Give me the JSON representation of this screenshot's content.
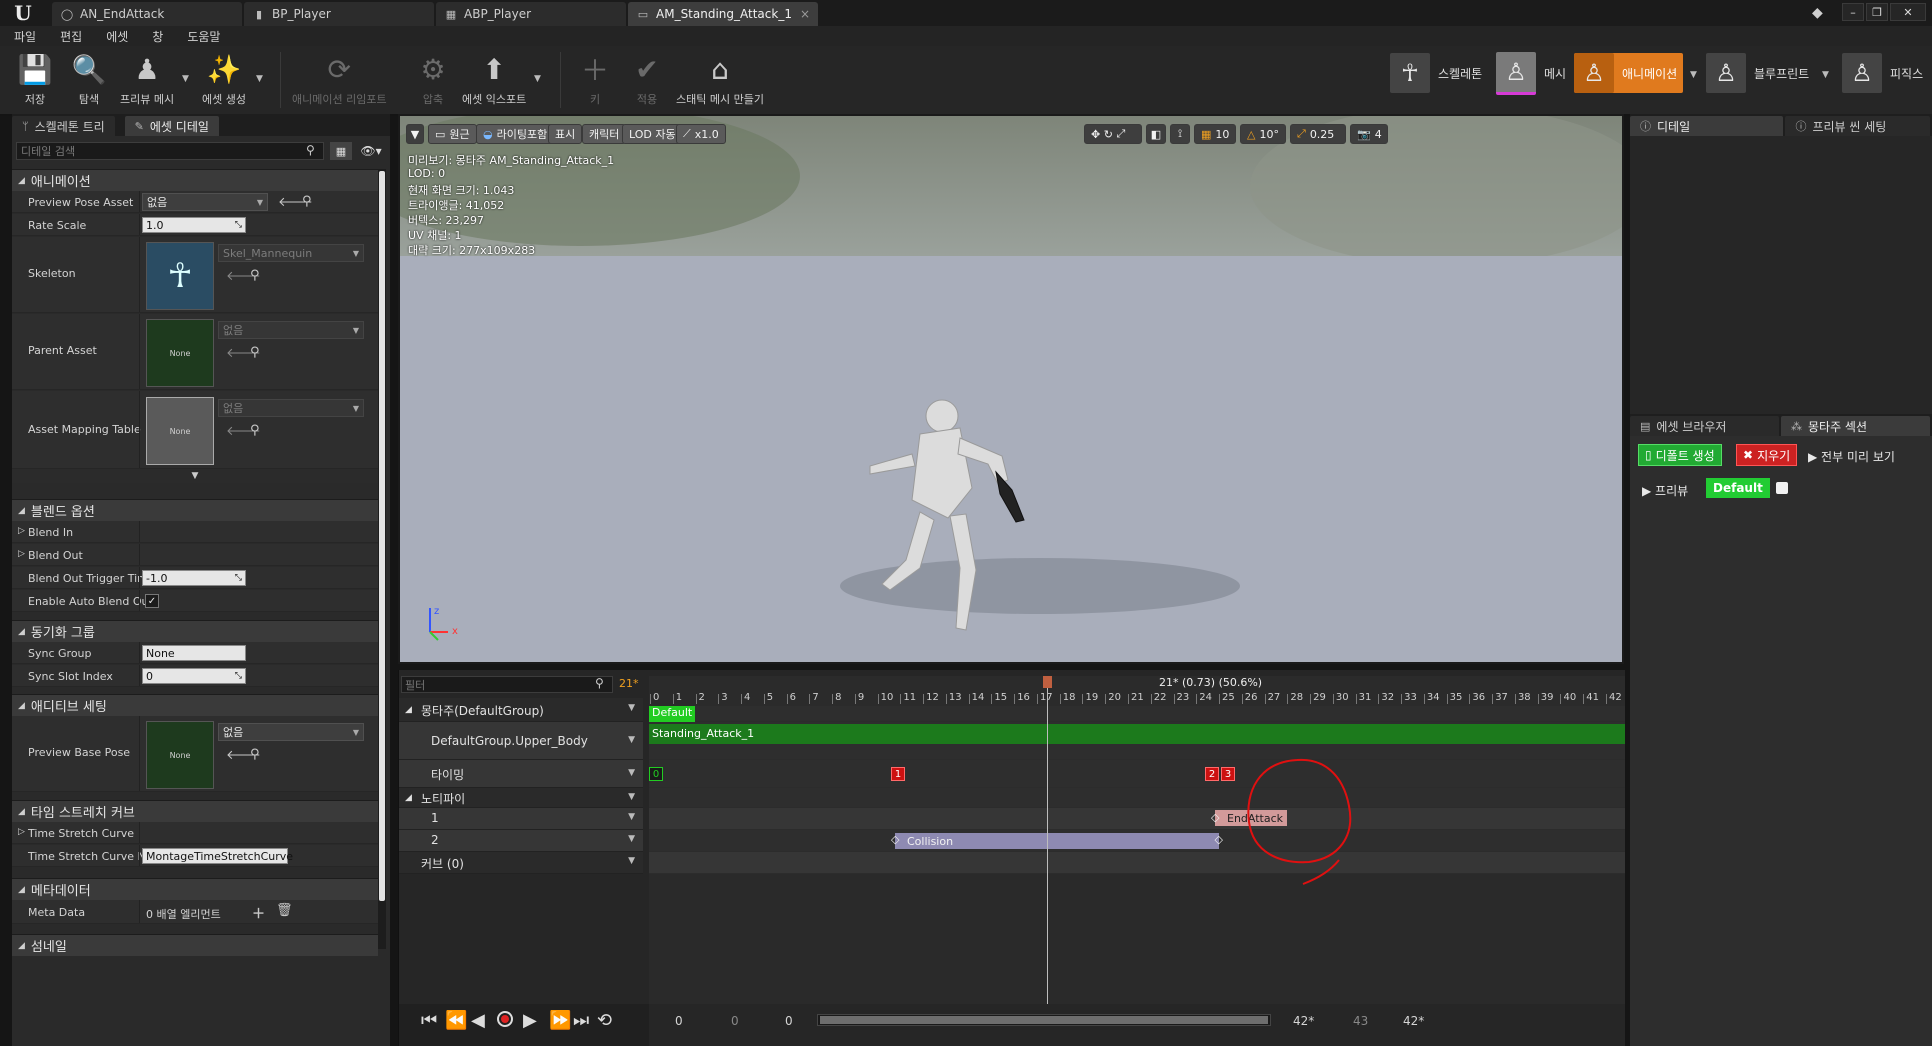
{
  "tabs": [
    {
      "label": "AN_EndAttack",
      "icon": "notify-circle-icon"
    },
    {
      "label": "BP_Player",
      "icon": "blueprint-icon"
    },
    {
      "label": "ABP_Player",
      "icon": "anim-blueprint-icon"
    },
    {
      "label": "AM_Standing_Attack_1",
      "icon": "montage-icon"
    }
  ],
  "menu": [
    "파일",
    "편집",
    "에셋",
    "창",
    "도움말"
  ],
  "toolbar": {
    "save": "저장",
    "browse": "탐색",
    "preview_mesh": "프리뷰 메시",
    "create_asset": "에셋 생성",
    "anim_reimport": "애니메이션 리임포트",
    "compress": "압축",
    "export_asset": "에셋 익스포트",
    "key": "키",
    "apply": "적용",
    "make_static_mesh": "스태틱 메시 만들기"
  },
  "modes": {
    "skeleton": "스켈레톤",
    "mesh": "메시",
    "animation": "애니메이션",
    "blueprint": "블루프린트",
    "physics": "피직스"
  },
  "details": {
    "tab_skeleton_tree": "스켈레톤 트리",
    "tab_asset_details": "에셋 디테일",
    "search_placeholder": "디테일 검색",
    "cat_animation": "애니메이션",
    "preview_pose_asset": "Preview Pose Asset",
    "preview_pose_value": "없음",
    "rate_scale": "Rate Scale",
    "rate_scale_value": "1.0",
    "skeleton": "Skeleton",
    "skeleton_value": "Skel_Mannequin",
    "parent_asset": "Parent Asset",
    "parent_asset_thumb": "None",
    "parent_asset_value": "없음",
    "asset_mapping": "Asset Mapping Table",
    "asset_mapping_thumb": "None",
    "asset_mapping_value": "없음",
    "cat_blend": "블렌드 옵션",
    "blend_in": "Blend In",
    "blend_out": "Blend Out",
    "blend_out_trigger": "Blend Out Trigger Tim",
    "blend_out_trigger_value": "-1.0",
    "auto_blend_out": "Enable Auto Blend Ou",
    "auto_blend_out_value": "✓",
    "cat_sync": "동기화 그룹",
    "sync_group": "Sync Group",
    "sync_group_value": "None",
    "sync_slot": "Sync Slot Index",
    "sync_slot_value": "0",
    "cat_additive": "애디티브 세팅",
    "preview_base_pose": "Preview Base Pose",
    "preview_base_thumb": "None",
    "preview_base_value": "없음",
    "cat_timestretch": "타임 스트레치 커브",
    "ts_curve": "Time Stretch Curve",
    "ts_curve_name": "Time Stretch Curve N",
    "ts_curve_name_value": "MontageTimeStretchCurve",
    "cat_metadata": "메타데이터",
    "meta_data": "Meta Data",
    "meta_data_value": "0 배열 엘리먼트",
    "cat_thumbnail": "섬네일"
  },
  "viewport": {
    "perspective": "원근",
    "lit": "라이팅포함",
    "show": "표시",
    "character": "캐릭터",
    "lod": "LOD 자동",
    "speed": "x1.0",
    "grid_snap": "10",
    "rot_snap": "10°",
    "scale_snap": "0.25",
    "cam_speed": "4",
    "info": [
      "미리보기: 몽타주 AM_Standing_Attack_1",
      "LOD: 0",
      "현재 화면 크기: 1.043",
      "트라이앵글: 41,052",
      "버텍스: 23,297",
      "UV 채널: 1",
      "대략 크기: 277x109x283"
    ],
    "axis_z": "z",
    "axis_x": "x"
  },
  "right_panel": {
    "tab_details": "디테일",
    "tab_preview_scene": "프리뷰 씬 세팅",
    "tab_asset_browser": "에셋 브라우저",
    "tab_montage_sections": "몽타주 섹션",
    "create_default": "디폴트 생성",
    "clear": "지우기",
    "preview_all": "▶ 전부 미리 보기",
    "preview": "▶ 프리뷰",
    "default_section": "Default"
  },
  "sequencer": {
    "filter_placeholder": "필터",
    "current_frame": "21*",
    "scrub_label": "21* (0.73) (50.6%)",
    "tracks": {
      "montage": "몽타주(DefaultGroup)",
      "slot": "DefaultGroup.Upper_Body",
      "timing": "타이밍",
      "notifies": "노티파이",
      "notify1": "1",
      "notify2": "2",
      "curves": "커브  (0)"
    },
    "section_default": "Default",
    "segment_name": "Standing_Attack_1",
    "timing_markers": [
      "0",
      "1",
      "2",
      "3"
    ],
    "notify_endattack": "EndAttack",
    "notify_collision": "Collision",
    "ticks": [
      "0",
      "1",
      "2",
      "3",
      "4",
      "5",
      "6",
      "7",
      "8",
      "9",
      "10",
      "11",
      "12",
      "13",
      "14",
      "15",
      "16",
      "17",
      "18",
      "19",
      "20",
      "21",
      "22",
      "23",
      "24",
      "25",
      "26",
      "27",
      "28",
      "29",
      "30",
      "31",
      "32",
      "33",
      "34",
      "35",
      "36",
      "37",
      "38",
      "39",
      "40",
      "41",
      "42"
    ],
    "footer": {
      "start": "0",
      "start2": "0",
      "current": "0",
      "end": "42*",
      "end_frames": "43",
      "end2": "42*"
    }
  }
}
